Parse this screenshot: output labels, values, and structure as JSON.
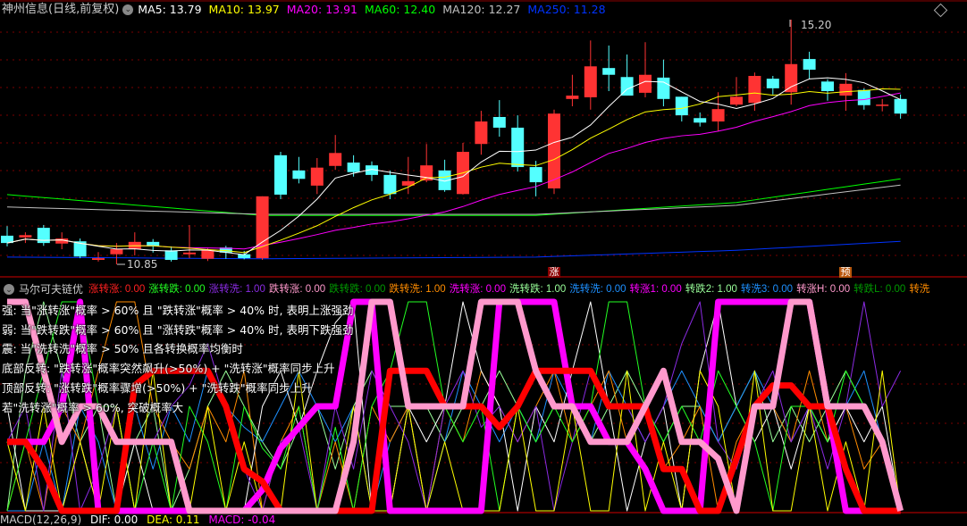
{
  "header": {
    "title": "神州信息(日线,前复权)",
    "ma": [
      {
        "label": "MA5: 13.79",
        "color": "#ffffff"
      },
      {
        "label": "MA10: 13.97",
        "color": "#ffff00"
      },
      {
        "label": "MA20: 13.91",
        "color": "#ff00ff"
      },
      {
        "label": "MA60: 12.40",
        "color": "#00ff00"
      },
      {
        "label": "MA120: 12.27",
        "color": "#c0c0c0"
      },
      {
        "label": "MA250: 11.28",
        "color": "#0033ff"
      }
    ]
  },
  "price_labels": {
    "high": "15.20",
    "low": "10.85"
  },
  "markers": {
    "up": "涨",
    "pre": "预"
  },
  "candles": [
    [
      11.36,
      11.53,
      11.17,
      11.23
    ],
    [
      11.33,
      11.42,
      11.23,
      11.37
    ],
    [
      11.5,
      11.55,
      11.18,
      11.23
    ],
    [
      11.22,
      11.42,
      11.12,
      11.31
    ],
    [
      11.26,
      11.31,
      10.96,
      10.99
    ],
    [
      10.93,
      11.07,
      10.9,
      10.96
    ],
    [
      11.03,
      11.23,
      10.85,
      11.12
    ],
    [
      11.12,
      11.42,
      11.01,
      11.25
    ],
    [
      11.25,
      11.3,
      11.06,
      11.17
    ],
    [
      11.1,
      11.17,
      10.9,
      10.93
    ],
    [
      11.03,
      11.55,
      10.96,
      11.06
    ],
    [
      10.95,
      11.15,
      10.91,
      11.1
    ],
    [
      11.15,
      11.18,
      10.95,
      11.06
    ],
    [
      11.03,
      11.09,
      10.94,
      10.96
    ],
    [
      10.96,
      12.06,
      10.93,
      12.06
    ],
    [
      12.79,
      12.85,
      12.01,
      12.09
    ],
    [
      12.52,
      12.76,
      12.29,
      12.37
    ],
    [
      12.25,
      12.74,
      12.1,
      12.57
    ],
    [
      12.6,
      13.15,
      12.53,
      12.83
    ],
    [
      12.66,
      12.79,
      12.41,
      12.49
    ],
    [
      12.61,
      12.68,
      12.33,
      12.44
    ],
    [
      12.44,
      12.52,
      12.01,
      12.1
    ],
    [
      12.25,
      12.76,
      12.1,
      12.33
    ],
    [
      12.34,
      12.99,
      12.31,
      12.61
    ],
    [
      12.52,
      12.71,
      12.14,
      12.17
    ],
    [
      12.1,
      13.01,
      12.09,
      12.85
    ],
    [
      12.99,
      13.58,
      12.8,
      13.39
    ],
    [
      13.47,
      13.77,
      13.12,
      13.28
    ],
    [
      13.28,
      13.5,
      12.5,
      12.58
    ],
    [
      12.58,
      12.69,
      12.06,
      12.31
    ],
    [
      12.2,
      13.6,
      12.1,
      13.53
    ],
    [
      13.79,
      14.22,
      13.66,
      13.85
    ],
    [
      13.82,
      14.83,
      13.6,
      14.37
    ],
    [
      14.34,
      14.74,
      13.93,
      14.22
    ],
    [
      14.18,
      14.58,
      13.85,
      13.85
    ],
    [
      13.9,
      14.8,
      13.82,
      14.22
    ],
    [
      14.17,
      14.49,
      13.66,
      13.79
    ],
    [
      13.83,
      13.83,
      13.39,
      13.5
    ],
    [
      13.45,
      13.55,
      13.3,
      13.37
    ],
    [
      13.39,
      13.91,
      13.22,
      13.61
    ],
    [
      13.69,
      14.18,
      13.66,
      13.83
    ],
    [
      13.72,
      14.26,
      13.58,
      14.2
    ],
    [
      14.15,
      14.2,
      13.87,
      13.98
    ],
    [
      13.91,
      15.2,
      13.69,
      14.41
    ],
    [
      14.5,
      14.63,
      14.15,
      14.31
    ],
    [
      14.1,
      14.14,
      13.76,
      13.93
    ],
    [
      13.85,
      14.25,
      13.58,
      14.06
    ],
    [
      13.95,
      13.98,
      13.6,
      13.68
    ],
    [
      13.69,
      13.79,
      13.57,
      13.69
    ],
    [
      13.79,
      13.87,
      13.44,
      13.53
    ]
  ],
  "long_ma": {
    "ma60": [
      [
        0,
        12.09
      ],
      [
        14,
        11.72
      ],
      [
        29,
        11.72
      ],
      [
        40,
        11.95
      ],
      [
        49,
        12.37
      ]
    ],
    "ma120": [
      [
        0,
        11.87
      ],
      [
        14,
        11.74
      ],
      [
        29,
        11.74
      ],
      [
        40,
        11.9
      ],
      [
        49,
        12.26
      ]
    ],
    "ma250": [
      [
        0,
        10.98
      ],
      [
        14,
        10.95
      ],
      [
        29,
        10.98
      ],
      [
        40,
        11.1
      ],
      [
        49,
        11.26
      ]
    ]
  },
  "colors": {
    "up": "#ff3333",
    "down": "#54ffff",
    "grid": "#7a0000"
  },
  "markov": {
    "title": "马尔可夫链优",
    "legend": [
      {
        "label": "涨转涨: 0.00",
        "color": "#ff2020"
      },
      {
        "label": "涨转跌: 0.00",
        "color": "#22ff22"
      },
      {
        "label": "涨转洗: 1.00",
        "color": "#8a2be2"
      },
      {
        "label": "跌转涨: 0.00",
        "color": "#ff99cc"
      },
      {
        "label": "跌转跌: 0.00",
        "color": "#009900"
      },
      {
        "label": "跌转洗: 1.00",
        "color": "#ff8c00"
      },
      {
        "label": "洗转涨: 0.00",
        "color": "#ff00ff"
      },
      {
        "label": "洗转跌: 1.00",
        "color": "#99ff99"
      },
      {
        "label": "洗转洗: 0.00",
        "color": "#1e90ff"
      },
      {
        "label": "转涨1: 0.00",
        "color": "#ff00ff"
      },
      {
        "label": "转跌2: 1.00",
        "color": "#99ff99"
      },
      {
        "label": "转洗3: 0.00",
        "color": "#1e90ff"
      },
      {
        "label": "转涨H: 0.00",
        "color": "#ff99cc"
      },
      {
        "label": "转跌L: 0.00",
        "color": "#009900"
      },
      {
        "label": "转洗",
        "color": "#ff8c00"
      }
    ],
    "notes": [
      "强: 当\"涨转涨\"概率 > 60% 且 \"跌转涨\"概率 > 40% 时, 表明上涨强劲",
      "弱: 当\"跌转跌\"概率 > 60% 且 \"涨转跌\"概率 > 40% 时, 表明下跌强劲",
      "震: 当\"洗转洗\"概率 > 50% 且各转换概率均衡时",
      "底部反转: \"跌转涨\"概率突然飙升(>50%) + \"洗转涨\"概率同步上升",
      "顶部反转: \"涨转跌\"概率骤增(>50%) + \"洗转跌\"概率同步上升",
      "若\"洗转涨\"概率 > 60%, 突破概率大"
    ],
    "series": [
      {
        "color": "#ff99cc",
        "width": 7,
        "values": [
          1,
          1,
          0.67,
          0.33,
          0.5,
          0.5,
          0.33,
          0.33,
          0.33,
          0.33,
          0,
          0,
          0,
          0,
          0,
          0,
          0,
          0,
          0,
          0.33,
          1,
          1,
          0.5,
          0.5,
          0.5,
          0.5,
          1,
          1,
          1,
          0.67,
          0.5,
          0.5,
          0.33,
          0.33,
          0.33,
          0.5,
          0.67,
          0.33,
          0.33,
          0.25,
          0,
          0.5,
          0.5,
          1,
          1,
          0.5,
          0.5,
          0.5,
          0.33,
          0
        ]
      },
      {
        "color": "#ff0000",
        "width": 7,
        "values": [
          0.33,
          0.33,
          0.2,
          0,
          0,
          0,
          0,
          0.6,
          0.67,
          0.67,
          0.67,
          0.67,
          0.5,
          0.2,
          0.14,
          0,
          0,
          0,
          0,
          0,
          0,
          0.67,
          0.67,
          0.67,
          0.5,
          0.5,
          0.5,
          0.4,
          0.5,
          0.67,
          0.67,
          0.67,
          0.67,
          0.5,
          0.5,
          0.5,
          0.2,
          0.2,
          0,
          0,
          0.25,
          0.5,
          0.6,
          0.6,
          0.5,
          0.5,
          0.2,
          0,
          0,
          0
        ]
      },
      {
        "color": "#ff00ff",
        "width": 7,
        "values": [
          0.33,
          0.33,
          0.33,
          0.5,
          1,
          0,
          0,
          0,
          0,
          0,
          0,
          0,
          0,
          0,
          0.1,
          0.3,
          0.4,
          0.5,
          0.5,
          1,
          1,
          0,
          0,
          0,
          0,
          0,
          0,
          1,
          1,
          1,
          1,
          0.5,
          0.5,
          0.33,
          0.33,
          0.2,
          0,
          0,
          0,
          1,
          1,
          1,
          1,
          1,
          1,
          0.5,
          0,
          0,
          0,
          0
        ]
      },
      {
        "color": "#ffff00",
        "width": 1,
        "values": [
          0.33,
          0,
          0.5,
          0,
          0.33,
          0,
          0.5,
          0,
          0.67,
          0,
          0,
          0.5,
          0,
          0.33,
          0,
          0,
          0.67,
          0,
          0,
          0.5,
          0,
          0,
          0.5,
          0,
          0.33,
          0,
          0,
          0,
          0.5,
          0,
          0,
          0.5,
          0,
          0,
          0.67,
          0,
          0.33,
          0,
          0.67,
          0.5,
          0,
          0.67,
          0,
          0,
          0.5,
          0,
          0.33,
          0,
          0.67,
          0
        ]
      },
      {
        "color": "#22ff22",
        "width": 1,
        "values": [
          0,
          0.33,
          0.67,
          1,
          1,
          0.5,
          0.5,
          0,
          0.33,
          0,
          0.5,
          0.33,
          0,
          0.5,
          0.3,
          0.2,
          0.5,
          0,
          0.4,
          0,
          0.5,
          0.67,
          1,
          1,
          0.5,
          0.33,
          0.5,
          0,
          0.5,
          0.33,
          0.5,
          0.33,
          0.5,
          1,
          1,
          0.5,
          0.33,
          0.5,
          0.33,
          0.67,
          0.5,
          0.33,
          0,
          0.5,
          0.5,
          0.33,
          0.67,
          0.5,
          0.33,
          0
        ]
      },
      {
        "color": "#8a2be2",
        "width": 1,
        "values": [
          0.33,
          0.5,
          0,
          0.67,
          0,
          0.2,
          0.5,
          0,
          0.33,
          0.5,
          0.6,
          0.8,
          0.5,
          0.2,
          0,
          0.33,
          0.4,
          0,
          0.5,
          0.2,
          0.67,
          0.5,
          0.33,
          0,
          0.5,
          0.67,
          0.4,
          0.5,
          0.33,
          0.5,
          0,
          0.33,
          0.67,
          0.5,
          0.5,
          0.33,
          0.5,
          0.8,
          1,
          0.33,
          0.2,
          0.5,
          0.67,
          0.33,
          0.5,
          0.2,
          0.5,
          1,
          0.5,
          0.67
        ]
      },
      {
        "color": "#ffffff",
        "width": 1,
        "values": [
          0.5,
          0,
          0,
          0,
          0.33,
          0,
          0,
          0.33,
          0,
          0,
          0,
          0,
          0,
          0,
          0.5,
          0.67,
          0.4,
          0.67,
          0.9,
          1,
          0,
          0,
          0.5,
          0.33,
          0.5,
          1,
          0.67,
          0.5,
          0,
          0.5,
          0.33,
          0.67,
          1,
          0.5,
          0,
          0.33,
          0.5,
          0,
          0.67,
          1,
          0.5,
          0.33,
          0.5,
          0.2,
          0.5,
          0.33,
          0.5,
          0.33,
          0.5,
          0
        ]
      },
      {
        "color": "#ff8c00",
        "width": 1,
        "values": [
          0,
          0.33,
          0,
          0.5,
          0.33,
          0.67,
          1,
          1,
          0.5,
          0.33,
          0.2,
          0.5,
          0.33,
          0.67,
          0,
          0.33,
          0.5,
          0,
          0.33,
          0,
          0.5,
          0.33,
          0.5,
          0,
          0.5,
          0.33,
          0.67,
          0.5,
          0.33,
          0.5,
          0.67,
          0.33,
          0.5,
          0.67,
          0.33,
          0.5,
          0.2,
          0.33,
          0.5,
          0,
          0.33,
          0.5,
          0.5,
          0.33,
          0.67,
          0.33,
          0.5,
          0.2,
          0.33,
          0
        ]
      },
      {
        "color": "#1e90ff",
        "width": 1,
        "values": [
          0,
          0,
          0.33,
          0,
          0.5,
          0.33,
          0,
          0.5,
          0.2,
          0.5,
          0.33,
          0.67,
          0.5,
          0.4,
          0.33,
          0.5,
          0.67,
          0.5,
          0.33,
          0.5,
          0,
          0.33,
          0.5,
          0,
          0.33,
          0.67,
          0.5,
          0.33,
          0.5,
          0.33,
          0.67,
          0.5,
          0.33,
          0.67,
          0.5,
          0.33,
          0.5,
          0.67,
          0.5,
          0.33,
          0.5,
          0.67,
          0.5,
          0.33,
          0.5,
          0.33,
          0.5,
          0.67,
          0.33,
          0
        ]
      },
      {
        "color": "#99ff99",
        "width": 1,
        "values": [
          0,
          0.67,
          1,
          0.67,
          0.33,
          0.5,
          0,
          0.33,
          0.5,
          0,
          0.2,
          0.5,
          0.67,
          0.5,
          0.33,
          0.2,
          0.4,
          0.5,
          0.2,
          0.5,
          0.67,
          0.5,
          0.5,
          0.5,
          0.33,
          0.5,
          0.5,
          0.67,
          0.5,
          0.33,
          0.5,
          0.5,
          0.33,
          0.5,
          0.67,
          0.5,
          0.33,
          0.5,
          0.5,
          0.33,
          0.5,
          0.67,
          0.33,
          0.5,
          0.33,
          0.5,
          0.67,
          0.5,
          0.33,
          0
        ]
      }
    ]
  },
  "macd": {
    "label": "MACD(12,26,9)",
    "dif": "DIF: 0.00",
    "dea": "DEA: 0.11",
    "macd": "MACD: -0.04"
  }
}
